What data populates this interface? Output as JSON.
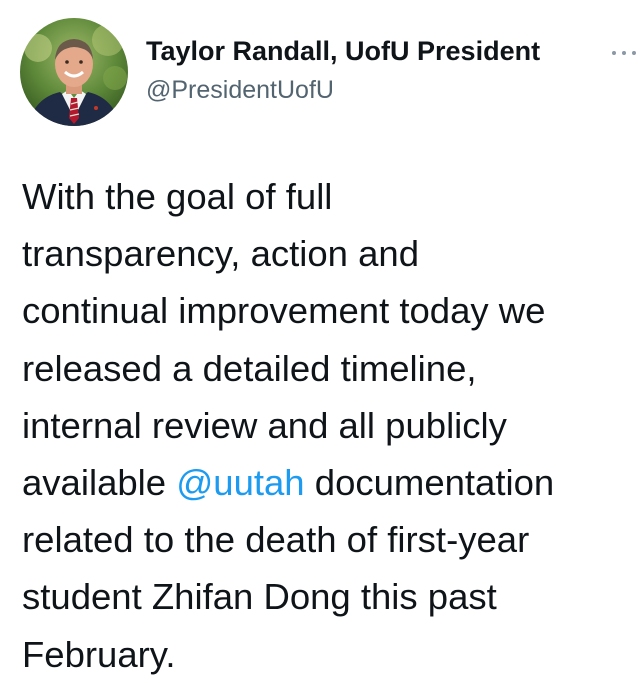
{
  "author": {
    "display_name": "Taylor Randall, UofU President",
    "handle": "@PresidentUofU"
  },
  "menu_icon": "more-horizontal-icon",
  "colors": {
    "text": "#0f1419",
    "secondary": "#536471",
    "link": "#1d9bf0"
  },
  "tweet": {
    "lines": [
      "With the goal of full",
      "transparency, action and",
      "continual improvement today we",
      "released a detailed timeline,",
      "internal review and all publicly"
    ],
    "line6_before": "available ",
    "mention": "@uutah",
    "line6_after": " documentation",
    "lines_end": [
      "related to the death of first-year",
      "student Zhifan Dong this past",
      "February."
    ]
  }
}
